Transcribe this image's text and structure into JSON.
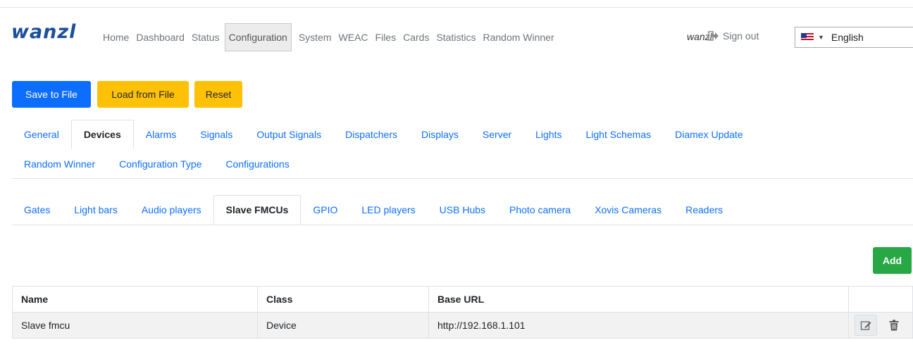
{
  "brand": "wanzl",
  "nav": {
    "items": [
      "Home",
      "Dashboard",
      "Status",
      "Configuration",
      "System",
      "WEAC",
      "Files",
      "Cards",
      "Statistics",
      "Random Winner"
    ],
    "active": "Configuration"
  },
  "user": {
    "name": "wanzl",
    "signout_label": "Sign out"
  },
  "language": {
    "selected": "English",
    "flag_icon": "us-flag-icon"
  },
  "actions": {
    "save_label": "Save to File",
    "load_label": "Load from File",
    "reset_label": "Reset"
  },
  "config_tabs": {
    "row1": [
      "General",
      "Devices",
      "Alarms",
      "Signals",
      "Output Signals",
      "Dispatchers",
      "Displays",
      "Server",
      "Lights",
      "Light Schemas",
      "Diamex Update"
    ],
    "row2": [
      "Random Winner",
      "Configuration Type",
      "Configurations"
    ],
    "active": "Devices"
  },
  "device_tabs": {
    "items": [
      "Gates",
      "Light bars",
      "Audio players",
      "Slave FMCUs",
      "GPIO",
      "LED players",
      "USB Hubs",
      "Photo camera",
      "Xovis Cameras",
      "Readers"
    ],
    "active": "Slave FMCUs"
  },
  "add_label": "Add",
  "table": {
    "columns": [
      "Name",
      "Class",
      "Base URL",
      ""
    ],
    "rows": [
      {
        "name": "Slave fmcu",
        "class": "Device",
        "base_url": "http://192.168.1.101",
        "edit_icon": "edit-icon",
        "delete_icon": "trash-icon"
      }
    ]
  },
  "colors": {
    "primary": "#0d6efd",
    "warning": "#ffc107",
    "success": "#28a745",
    "brand": "#1c4f9c"
  }
}
